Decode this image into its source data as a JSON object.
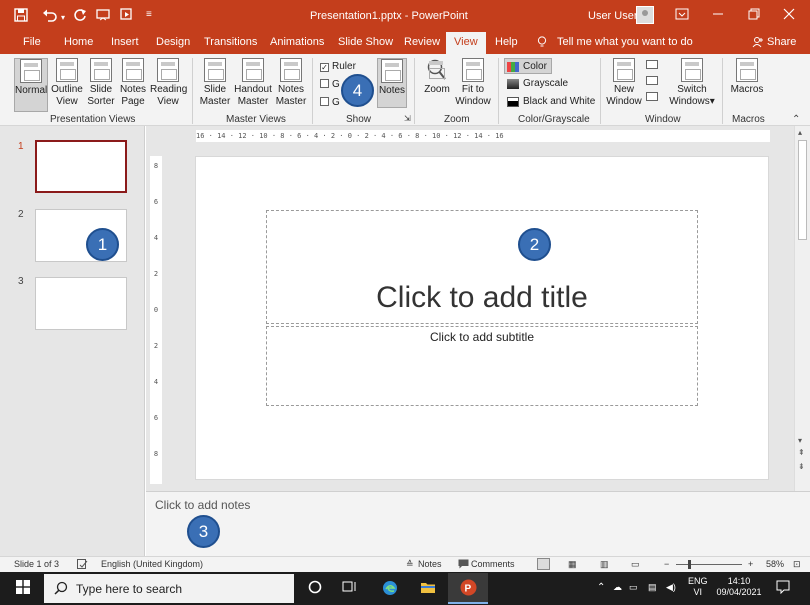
{
  "app": {
    "title": "Presentation1.pptx  -  PowerPoint",
    "user": "User User"
  },
  "titlebar_icons": {
    "save": "save-icon",
    "undo": "undo-icon",
    "redo": "redo-icon"
  },
  "menu": {
    "tabs": [
      "File",
      "Home",
      "Insert",
      "Design",
      "Transitions",
      "Animations",
      "Slide Show",
      "Review",
      "View",
      "Help"
    ],
    "active": "View",
    "tell_me": "Tell me what you want to do",
    "share": "Share"
  },
  "ribbon": {
    "presentation_views": {
      "label": "Presentation Views",
      "normal": "Normal",
      "outline_1": "Outline",
      "outline_2": "View",
      "sorter_1": "Slide",
      "sorter_2": "Sorter",
      "notes_page_1": "Notes",
      "notes_page_2": "Page",
      "reading_1": "Reading",
      "reading_2": "View"
    },
    "master_views": {
      "label": "Master Views",
      "slide_1": "Slide",
      "slide_2": "Master",
      "handout_1": "Handout",
      "handout_2": "Master",
      "notes_1": "Notes",
      "notes_2": "Master"
    },
    "show": {
      "label": "Show",
      "ruler": "Ruler",
      "gridlines_partial": "G",
      "guides_partial": "G",
      "notes": "Notes",
      "ruler_checked": true
    },
    "zoom": {
      "label": "Zoom",
      "zoom": "Zoom",
      "fit_1": "Fit to",
      "fit_2": "Window"
    },
    "color": {
      "label": "Color/Grayscale",
      "color": "Color",
      "grayscale": "Grayscale",
      "bw": "Black and White"
    },
    "window": {
      "label": "Window",
      "new_1": "New",
      "new_2": "Window",
      "switch_1": "Switch",
      "switch_2": "Windows"
    },
    "macros": {
      "label": "Macros",
      "macros": "Macros"
    }
  },
  "thumbnails": [
    {
      "number": "1",
      "selected": true
    },
    {
      "number": "2",
      "selected": false
    },
    {
      "number": "3",
      "selected": false
    }
  ],
  "rulers": {
    "horizontal": "16 · 14 · 12 · 10 · 8 · 6 · 4 · 2 · 0 · 2 · 4 · 6 · 8 · 10 · 12 · 14 · 16",
    "vertical": [
      "8",
      "6",
      "4",
      "2",
      "0",
      "2",
      "4",
      "6",
      "8"
    ]
  },
  "slide": {
    "title_placeholder": "Click to add title",
    "subtitle_placeholder": "Click to add subtitle"
  },
  "notes_placeholder": "Click to add notes",
  "status": {
    "slide_of": "Slide 1 of 3",
    "language": "English (United Kingdom)",
    "notes": "Notes",
    "comments": "Comments",
    "zoom": "58%"
  },
  "taskbar": {
    "search_placeholder": "Type here to search",
    "lang_1": "ENG",
    "lang_2": "VI",
    "time": "14:10",
    "date": "09/04/2021"
  },
  "callouts": [
    "1",
    "2",
    "3",
    "4"
  ],
  "colors": {
    "accent": "#c43e1c",
    "callout": "#3a6fb5",
    "selected_thumb_border": "#8b1a1a"
  }
}
